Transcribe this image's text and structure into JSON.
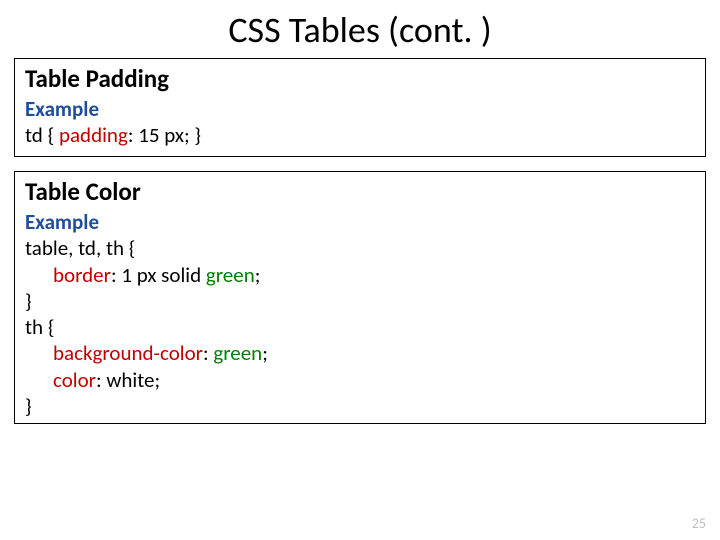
{
  "title": "CSS Tables (cont. )",
  "page_number": "25",
  "section1": {
    "heading": "Table Padding",
    "example_label": "Example",
    "line1a": "td { ",
    "line1_prop": "padding",
    "line1b": ": 15 px; }"
  },
  "section2": {
    "heading": "Table Color",
    "example_label": "Example",
    "line1": "table, td, th {",
    "line2_prop": "border",
    "line2_rest": ": 1 px solid ",
    "line2_green": "green",
    "line2_end": ";",
    "line3": "}",
    "line4": "th {",
    "line5_prop": "background-color",
    "line5_rest": ": ",
    "line5_green": "green",
    "line5_end": ";",
    "line6_prop": "color",
    "line6_rest": ": ",
    "line6_white": "white",
    "line6_end": ";",
    "line7": "}"
  }
}
